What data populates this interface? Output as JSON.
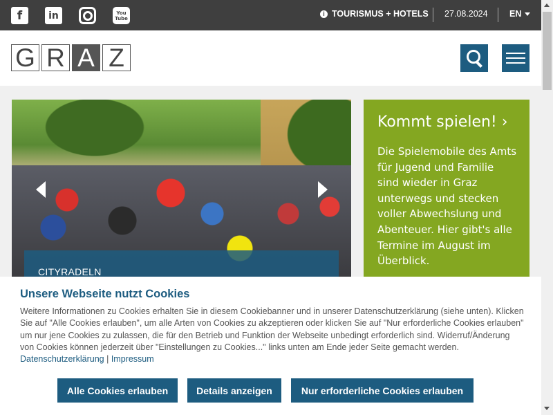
{
  "topbar": {
    "social": [
      "facebook-icon",
      "linkedin-icon",
      "instagram-icon",
      "youtube-icon"
    ],
    "facebook_glyph": "f",
    "linkedin_glyph": "in",
    "youtube_top": "You",
    "youtube_bottom": "Tube",
    "info_glyph": "i",
    "tourism_link": "TOURISMUS + HOTELS",
    "date": "27.08.2024",
    "language": "EN"
  },
  "header": {
    "logo_letters": [
      "G",
      "R",
      "A",
      "Z"
    ]
  },
  "hero": {
    "caption": "CITYRADELN"
  },
  "promo": {
    "title": "Kommt spielen! ›",
    "text": "Die Spielemobile des Amts für Jugend und Familie sind wieder in Graz unterwegs und stecken voller Abwechslung und Abenteuer. Hier gibt's alle Termine im August im Überblick.",
    "background": "#84a721"
  },
  "cookie": {
    "title": "Unsere Webseite nutzt Cookies",
    "text": "Weitere Informationen zu Cookies erhalten Sie in diesem Cookiebanner und in unserer Datenschutzerklärung (siehe unten). Klicken Sie auf \"Alle Cookies erlauben\", um alle Arten von Cookies zu akzeptieren oder klicken Sie auf \"Nur erforderliche Cookies erlauben\" um nur jene Cookies zu zulassen, die für den Betrieb und Funktion der Webseite unbedingt erforderlich sind. Widerruf/Änderung von Cookies können jederzeit über \"Einstellungen zu Cookies...\" links unten am Ende jeder Seite gemacht werden.",
    "privacy_link": "Datenschutzerklärung",
    "separator": "|",
    "imprint_link": "Impressum",
    "buttons": {
      "allow_all": "Alle Cookies erlauben",
      "details": "Details anzeigen",
      "required_only": "Nur erforderliche Cookies erlauben"
    }
  },
  "colors": {
    "accent": "#1d5c80",
    "topbar": "#3f3f3f"
  }
}
